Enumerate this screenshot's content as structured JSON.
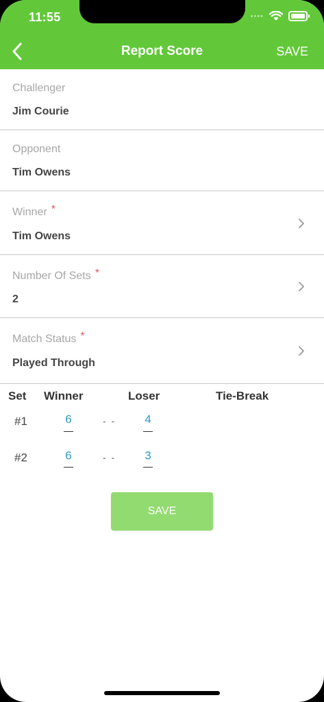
{
  "status_bar": {
    "time": "11:55"
  },
  "nav": {
    "title": "Report Score",
    "save_label": "SAVE"
  },
  "fields": {
    "challenger": {
      "label": "Challenger",
      "value": "Jim Courie"
    },
    "opponent": {
      "label": "Opponent",
      "value": "Tim Owens"
    },
    "winner": {
      "label": "Winner",
      "required": "*",
      "value": "Tim Owens"
    },
    "num_sets": {
      "label": "Number Of Sets",
      "required": "*",
      "value": "2"
    },
    "match_status": {
      "label": "Match Status",
      "required": "*",
      "value": "Played Through"
    }
  },
  "sets_table": {
    "headers": {
      "set": "Set",
      "winner": "Winner",
      "loser": "Loser",
      "tiebreak": "Tie-Break"
    },
    "separator": "- -",
    "rows": [
      {
        "set": "#1",
        "winner": "6",
        "loser": "4"
      },
      {
        "set": "#2",
        "winner": "6",
        "loser": "3"
      }
    ]
  },
  "save_button": {
    "label": "SAVE"
  },
  "colors": {
    "brand_green": "#62c83a",
    "button_green": "#92db71",
    "score_blue": "#2a9bc6",
    "required_red": "#e25757"
  }
}
